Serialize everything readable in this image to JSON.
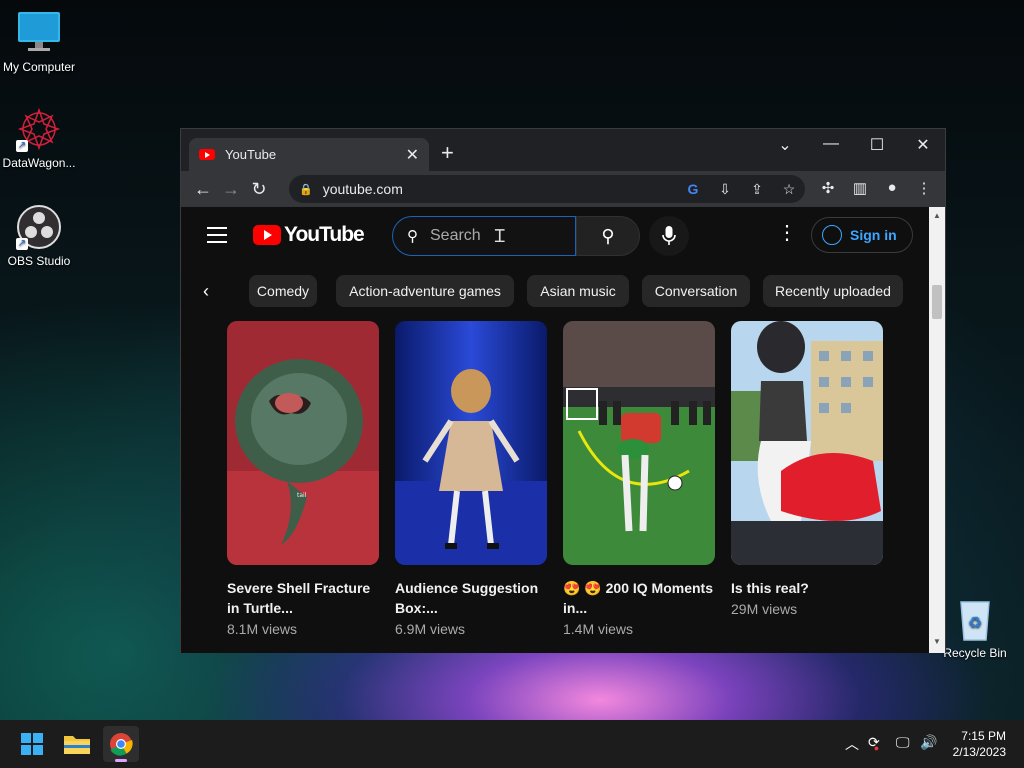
{
  "desktop": {
    "icons": [
      {
        "label": "My Computer",
        "icon": "monitor-icon"
      },
      {
        "label": "DataWagon...",
        "icon": "datawagon-icon"
      },
      {
        "label": "OBS Studio",
        "icon": "obs-icon"
      },
      {
        "label": "Recycle Bin",
        "icon": "recycle-bin-icon"
      }
    ]
  },
  "browser": {
    "tab_title": "YouTube",
    "url": "youtube.com"
  },
  "youtube": {
    "logo_text": "YouTube",
    "search_placeholder": "Search",
    "sign_in": "Sign in",
    "chips": [
      "Comedy",
      "Action-adventure games",
      "Asian music",
      "Conversation",
      "Recently uploaded"
    ],
    "videos": [
      {
        "title": "Severe Shell Fracture in Turtle...",
        "views": "8.1M views"
      },
      {
        "title": "Audience Suggestion Box:...",
        "views": "6.9M views"
      },
      {
        "title": "😍 😍 200 IQ Moments in...",
        "views": "1.4M views"
      },
      {
        "title": "Is this real?",
        "views": "29M views"
      }
    ]
  },
  "taskbar": {
    "time": "7:15 PM",
    "date": "2/13/2023"
  },
  "colors": {
    "accent": "#3ea6ff",
    "youtube_red": "#ff0000",
    "page_bg": "#0f0f0f"
  }
}
